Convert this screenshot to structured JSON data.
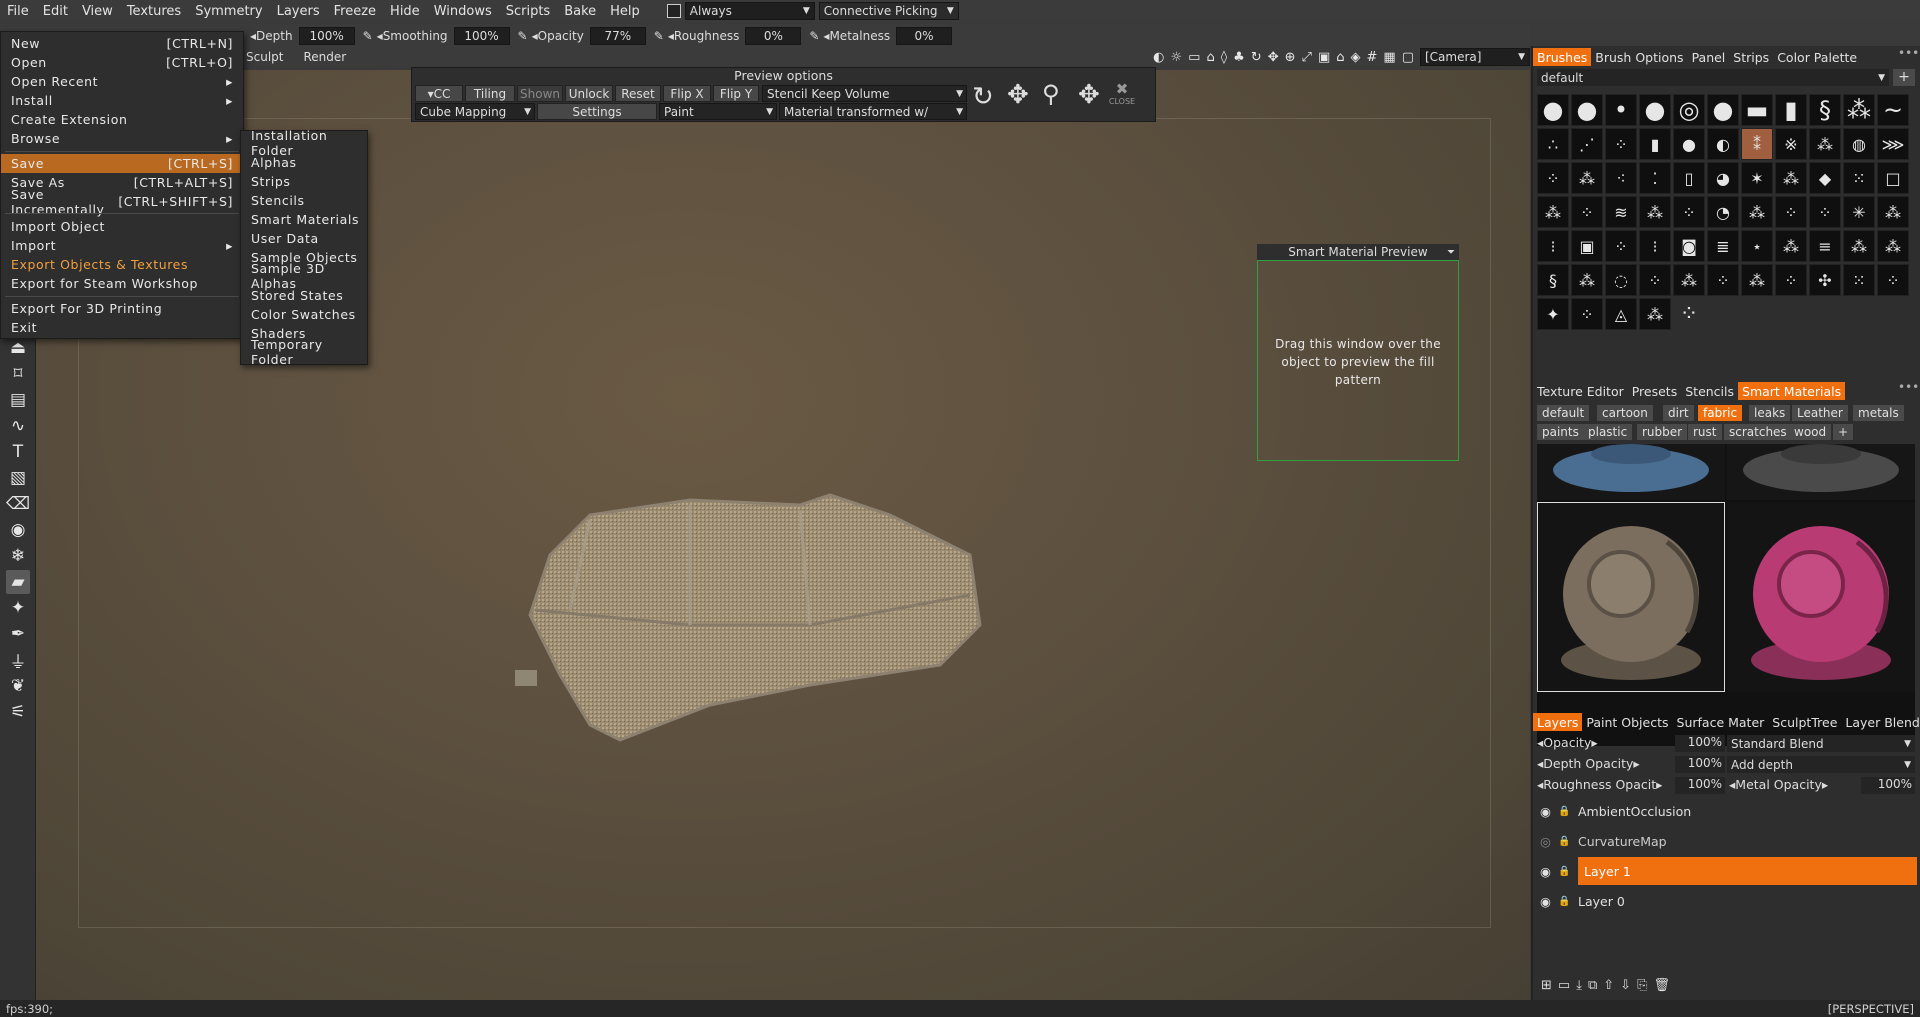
{
  "menubar": [
    "File",
    "Edit",
    "View",
    "Textures",
    "Symmetry",
    "Layers",
    "Freeze",
    "Hide",
    "Windows",
    "Scripts",
    "Bake",
    "Help"
  ],
  "always": "Always",
  "connective": "Connective Picking",
  "params": {
    "depth_label": "Depth",
    "depth": "100%",
    "smoothing_label": "Smoothing",
    "smoothing": "100%",
    "opacity_label": "Opacity",
    "opacity": "77%",
    "roughness_label": "Roughness",
    "roughness": "0%",
    "metalness_label": "Metalness",
    "metalness": "0%"
  },
  "room_tabs": [
    "Sculpt",
    "Render"
  ],
  "camera": "[Camera]",
  "file_menu": [
    {
      "label": "New",
      "shortcut": "[CTRL+N]"
    },
    {
      "label": "Open",
      "shortcut": "[CTRL+O]"
    },
    {
      "label": "Open Recent",
      "shortcut": "▸"
    },
    {
      "label": "Install",
      "shortcut": "▸"
    },
    {
      "label": "Create Extension",
      "shortcut": ""
    },
    {
      "label": "Browse",
      "shortcut": "▸"
    },
    {
      "label": "Save",
      "shortcut": "[CTRL+S]"
    },
    {
      "label": "Save As",
      "shortcut": "[CTRL+ALT+S]"
    },
    {
      "label": "Save Incrementally",
      "shortcut": "[CTRL+SHIFT+S]"
    },
    {
      "label": "Import Object",
      "shortcut": ""
    },
    {
      "label": "Import",
      "shortcut": "▸"
    },
    {
      "label": "Export Objects & Textures",
      "shortcut": ""
    },
    {
      "label": "Export for Steam Workshop",
      "shortcut": ""
    },
    {
      "label": "Export For 3D Printing",
      "shortcut": ""
    },
    {
      "label": "Exit",
      "shortcut": ""
    }
  ],
  "browse_submenu": [
    "Installation Folder",
    "Alphas",
    "Strips",
    "Stencils",
    "Smart Materials",
    "User Data",
    "Sample Objects",
    "Sample 3D Alphas",
    "Stored States",
    "Color Swatches",
    "Shaders",
    "Temporary Folder"
  ],
  "preview": {
    "title": "Preview options",
    "cc": "CC",
    "tiling": "Tiling",
    "shown": "Shown",
    "unlock": "Unlock",
    "reset": "Reset",
    "flipx": "Flip X",
    "flipy": "Flip Y",
    "stencil": "Stencil Keep Volume",
    "mapping": "Cube Mapping",
    "settings": "Settings",
    "paint": "Paint",
    "material": "Material transformed w/",
    "close": "CLOSE"
  },
  "smp": {
    "title": "Smart Material Preview",
    "text": "Drag this window over the object to preview the fill pattern"
  },
  "brush_tabs": [
    "Brushes",
    "Brush Options",
    "Panel",
    "Strips",
    "Color Palette"
  ],
  "brush_preset": "default",
  "sm_tabs": [
    "Texture Editor",
    "Presets",
    "Stencils",
    "Smart Materials"
  ],
  "sm_cats_row1": [
    "default",
    "cartoon",
    "dirt",
    "fabric",
    "leaks",
    "Leather",
    "metals"
  ],
  "sm_cats_row2": [
    "paints",
    "plastic",
    "rubber",
    "rust",
    "scratches",
    "wood"
  ],
  "layer_tabs": [
    "Layers",
    "Paint Objects",
    "Surface Mater",
    "SculptTree",
    "Layer Blendin"
  ],
  "layer_props": {
    "opacity_label": "Opacity",
    "opacity": "100%",
    "blend": "Standard Blend",
    "depth_label": "Depth Opacity",
    "depth": "100%",
    "depth_mode": "Add depth",
    "rough_label": "Roughness Opacit",
    "rough": "100%",
    "metal_label": "Metal Opacity",
    "metal": "100%"
  },
  "layers": [
    "AmbientOcclusion",
    "CurvatureMap",
    "Layer 1",
    "Layer 0"
  ],
  "status": {
    "fps": "fps:390;",
    "view": "[PERSPECTIVE]"
  }
}
